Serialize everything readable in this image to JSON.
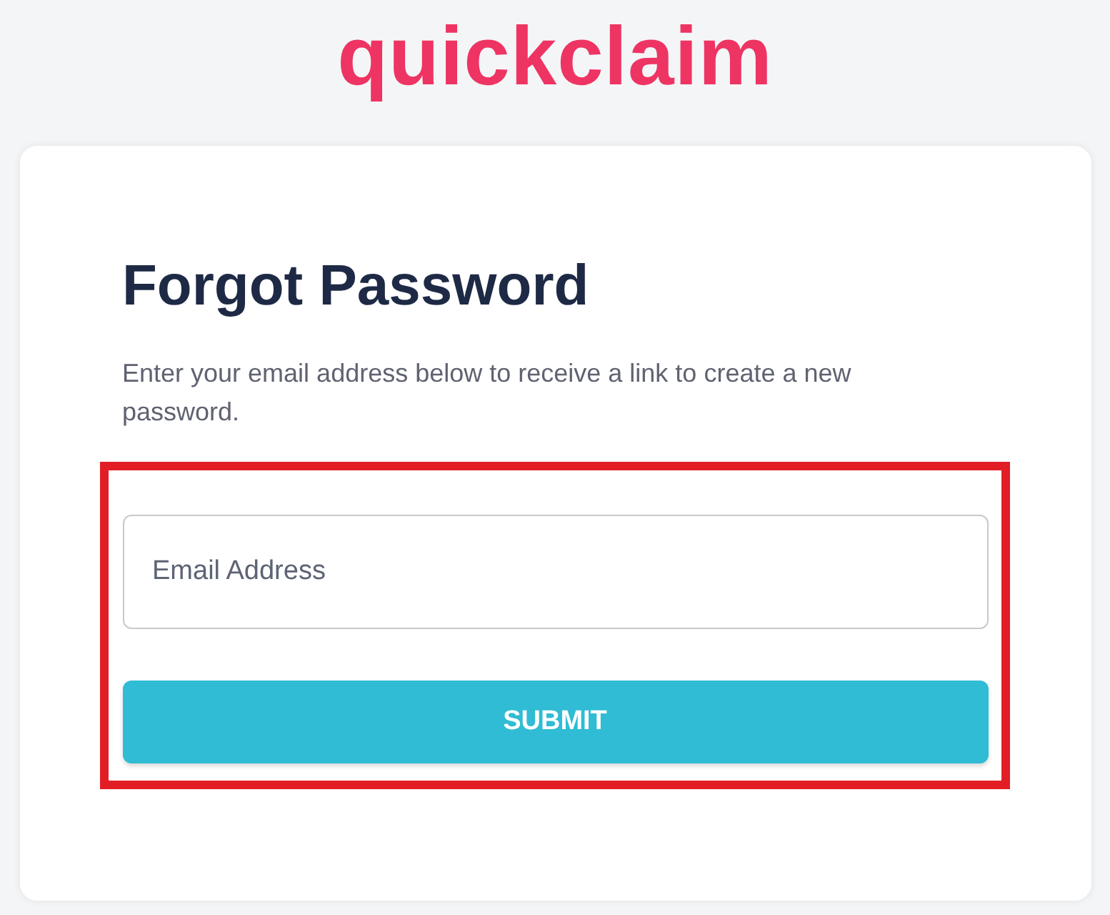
{
  "logo": {
    "text": "quickclaim"
  },
  "card": {
    "title": "Forgot Password",
    "description": "Enter your email address below to receive a link to create a new password.",
    "form": {
      "highlighted": true,
      "email_field": {
        "placeholder": "Email Address"
      },
      "submit_button": {
        "label": "SUBMIT"
      }
    }
  }
}
